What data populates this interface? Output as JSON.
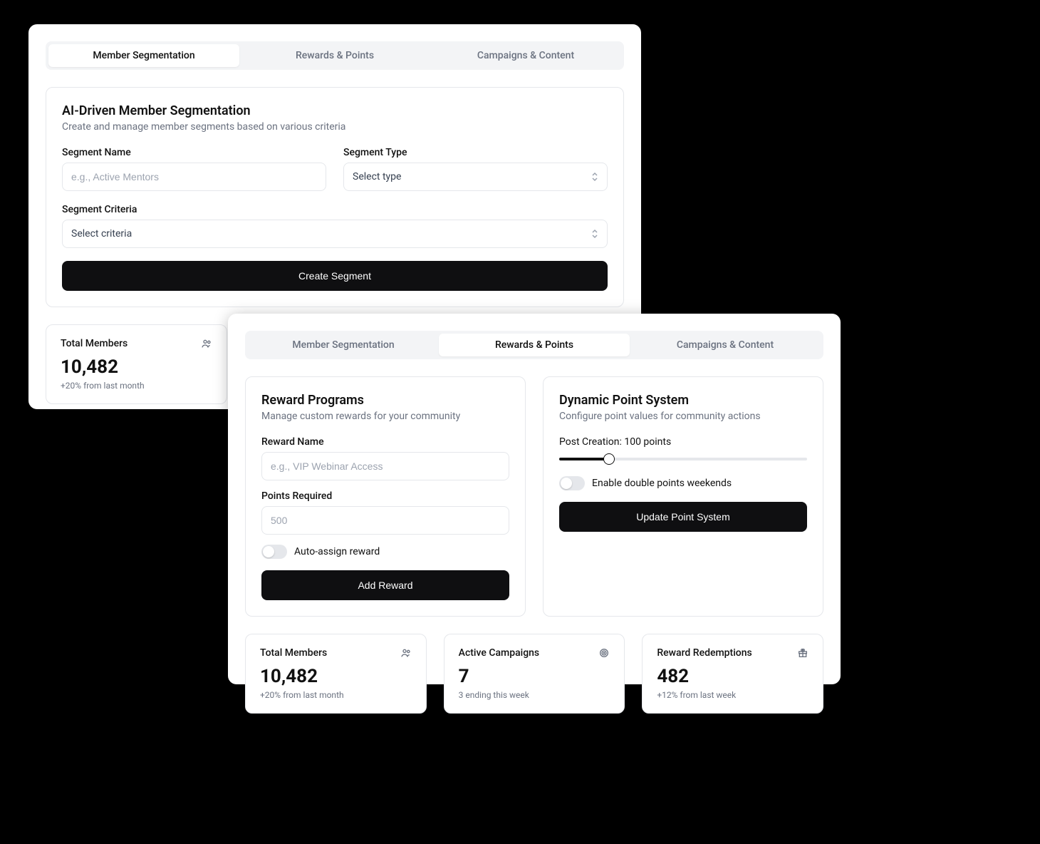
{
  "tabs": {
    "segmentation": "Member Segmentation",
    "rewards": "Rewards & Points",
    "campaigns": "Campaigns & Content"
  },
  "segmentation": {
    "title": "AI-Driven Member Segmentation",
    "subtitle": "Create and manage member segments based on various criteria",
    "segment_name_label": "Segment Name",
    "segment_name_placeholder": "e.g., Active Mentors",
    "segment_type_label": "Segment Type",
    "segment_type_placeholder": "Select type",
    "segment_criteria_label": "Segment Criteria",
    "segment_criteria_placeholder": "Select criteria",
    "create_button": "Create Segment"
  },
  "rewards": {
    "programs_title": "Reward Programs",
    "programs_subtitle": "Manage custom rewards for your community",
    "reward_name_label": "Reward Name",
    "reward_name_placeholder": "e.g., VIP Webinar Access",
    "points_required_label": "Points Required",
    "points_required_placeholder": "500",
    "auto_assign_label": "Auto-assign reward",
    "add_reward_button": "Add Reward",
    "points_title": "Dynamic Point System",
    "points_subtitle": "Configure point values for community actions",
    "post_creation_label": "Post Creation: 100 points",
    "slider_percent": 20,
    "double_points_label": "Enable double points weekends",
    "update_button": "Update Point System"
  },
  "stats": {
    "total_members_label": "Total Members",
    "total_members_value": "10,482",
    "total_members_note": "+20% from last month",
    "active_campaigns_label": "Active Campaigns",
    "active_campaigns_value": "7",
    "active_campaigns_note": "3 ending this week",
    "redemptions_label": "Reward Redemptions",
    "redemptions_value": "482",
    "redemptions_note": "+12% from last week"
  }
}
